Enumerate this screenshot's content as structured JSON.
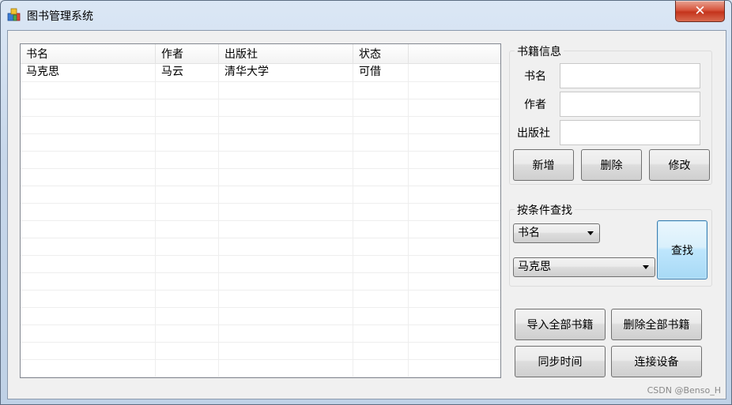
{
  "window": {
    "title": "图书管理系统",
    "close_symbol": "✕"
  },
  "grid": {
    "columns": [
      "书名",
      "作者",
      "出版社",
      "状态"
    ],
    "rows": [
      [
        "马克思",
        "马云",
        "清华大学",
        "可借"
      ]
    ]
  },
  "book_info": {
    "group_title": "书籍信息",
    "name_label": "书名",
    "author_label": "作者",
    "publisher_label": "出版社",
    "name_value": "",
    "author_value": "",
    "publisher_value": "",
    "add_label": "新增",
    "delete_label": "删除",
    "modify_label": "修改"
  },
  "search": {
    "group_title": "按条件查找",
    "field_selected": "书名",
    "value_selected": "马克思",
    "search_label": "查找"
  },
  "actions": {
    "import_all": "导入全部书籍",
    "delete_all": "删除全部书籍",
    "sync_time": "同步时间",
    "connect_device": "连接设备"
  },
  "watermark": "CSDN @Benso_H"
}
